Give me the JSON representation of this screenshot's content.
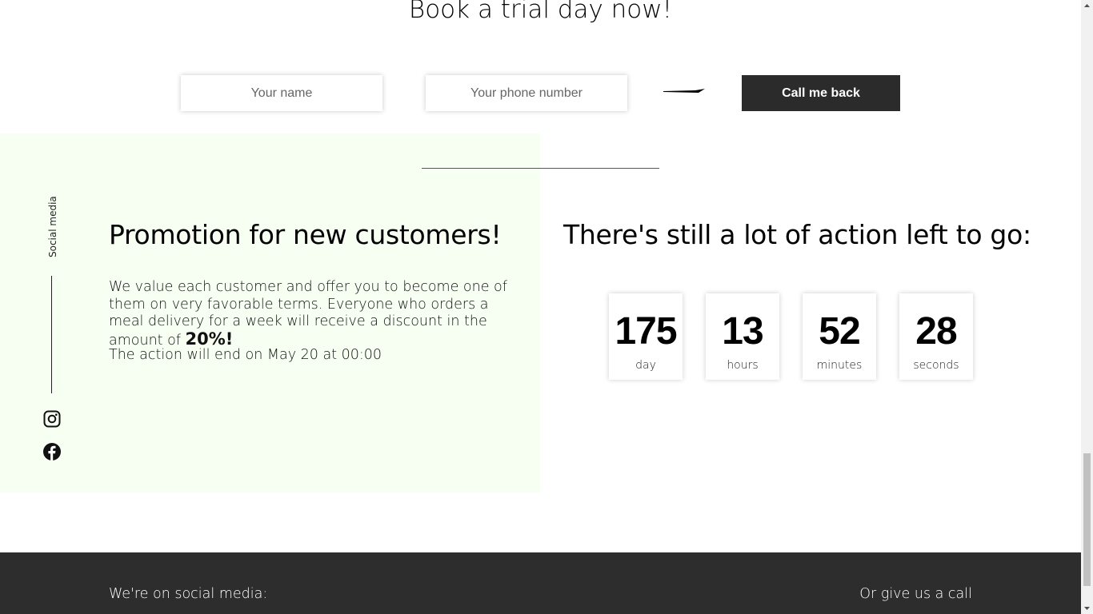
{
  "booking": {
    "title": "Book a trial day now!",
    "name_placeholder": "Your name",
    "phone_placeholder": "Your phone number",
    "button_label": "Call me back"
  },
  "social_sidebar": {
    "label": "Social media",
    "icons": [
      "instagram-icon",
      "facebook-icon"
    ]
  },
  "promo": {
    "title": "Promotion for new customers!",
    "text_before": "We value each customer and offer you to become one of them on very favorable terms. Everyone who orders a meal delivery for a week will receive a discount in the amount of",
    "discount": "20%!",
    "end_text": "The action will end on May 20 at 00:00"
  },
  "countdown": {
    "title": "There's still a lot of action left to go:",
    "units": [
      {
        "value": "175",
        "label": "day"
      },
      {
        "value": "13",
        "label": "hours"
      },
      {
        "value": "52",
        "label": "minutes"
      },
      {
        "value": "28",
        "label": "seconds"
      }
    ]
  },
  "footer": {
    "social_title": "We're on social media:",
    "call_title": "Or give us a call"
  },
  "colors": {
    "promo_bg": "#f7fff3",
    "button_bg": "#2b2b2b",
    "footer_bg": "#2d2d2d"
  }
}
